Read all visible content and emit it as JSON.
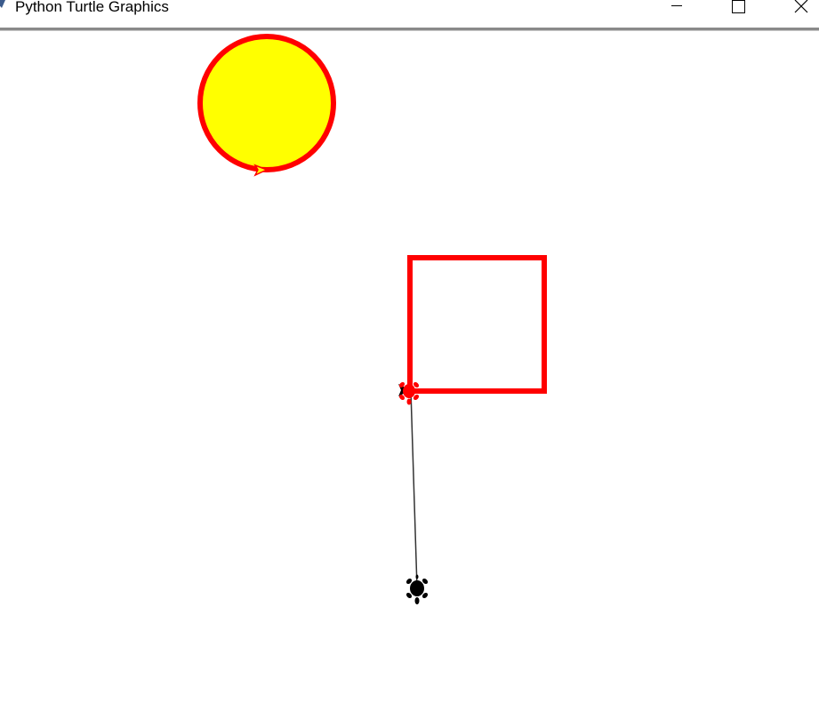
{
  "window": {
    "title": "Python Turtle Graphics",
    "controls": [
      "minimize-icon",
      "maximize-icon",
      "close-icon"
    ]
  },
  "canvas": {
    "background": "#ffffff",
    "shapes": [
      {
        "kind": "circle",
        "fill": "#ffff00",
        "outline": "#ff0000"
      },
      {
        "kind": "square",
        "outline": "#ff0000"
      },
      {
        "kind": "line",
        "stroke": "#000000"
      }
    ],
    "turtles": [
      {
        "shape": "arrow-icon",
        "fill": "#ffff00",
        "outline": "#ff0000"
      },
      {
        "shape": "arrow-icon",
        "fill": "#000000"
      },
      {
        "shape": "turtle-icon",
        "fill": "#ff0000"
      },
      {
        "shape": "turtle-icon",
        "fill": "#000000"
      }
    ]
  }
}
